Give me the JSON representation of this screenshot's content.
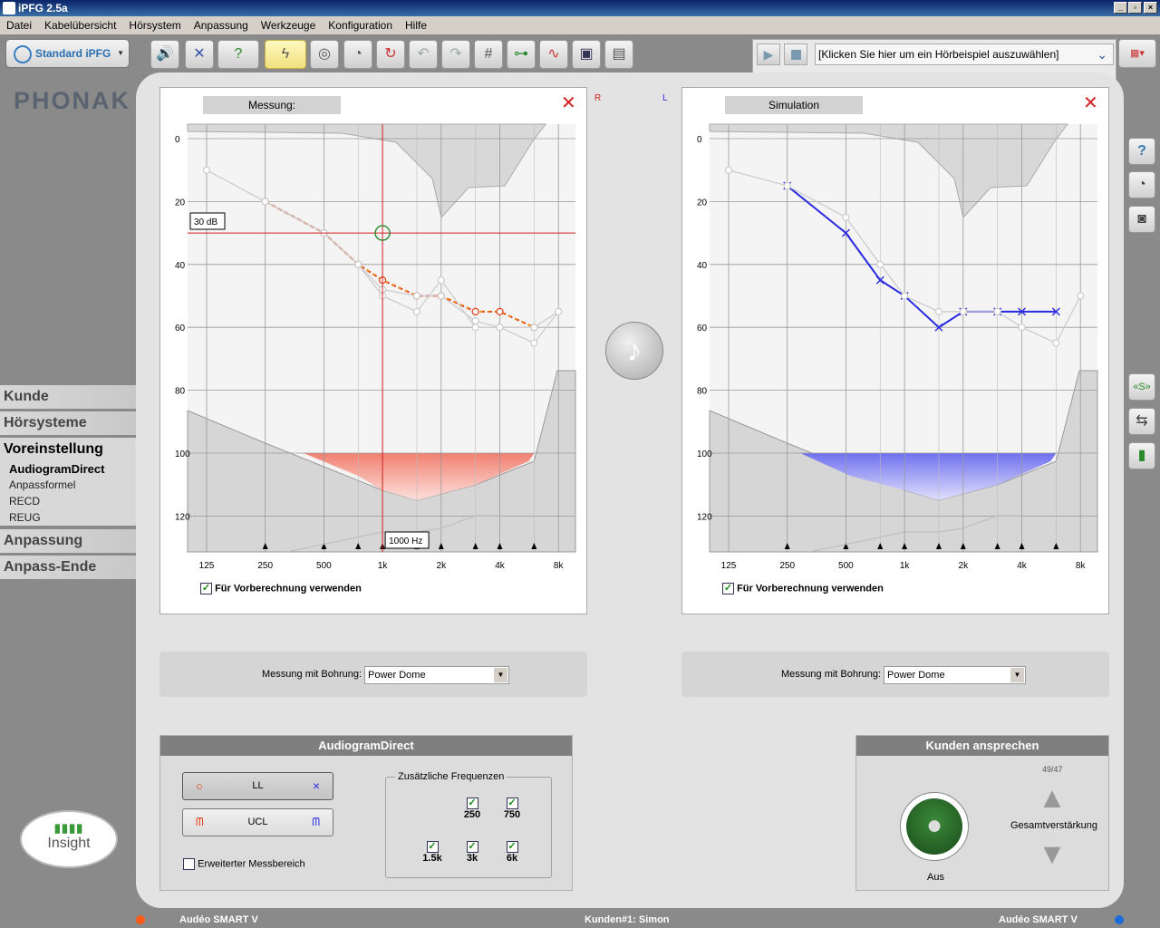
{
  "window": {
    "title": "iPFG 2.5a"
  },
  "menu": [
    "Datei",
    "Kabelübersicht",
    "Hörsystem",
    "Anpassung",
    "Werkzeuge",
    "Konfiguration",
    "Hilfe"
  ],
  "toolbar": {
    "profile_label": "Standard iPFG"
  },
  "sound": {
    "selector_text": "[Klicken Sie hier um ein Hörbeispiel auszuwählen]"
  },
  "brand": {
    "logo": "PHONAK",
    "insight": "Insight"
  },
  "nav": {
    "kunde": "Kunde",
    "horsysteme": "Hörsysteme",
    "voreinstellung": "Voreinstellung",
    "sub": [
      "AudiogramDirect",
      "Anpassformel",
      "RECD",
      "REUG"
    ],
    "anpassung": "Anpassung",
    "anpass_ende": "Anpass-Ende"
  },
  "left_panel": {
    "title": "Messung:",
    "side_label": "R",
    "cursor_db": "30 dB",
    "cursor_freq": "1000 Hz",
    "checkbox": "Für Vorberechnung verwenden"
  },
  "right_panel": {
    "title": "Simulation",
    "side_label": "L",
    "checkbox": "Für Vorberechnung verwenden"
  },
  "bohrung": {
    "label": "Messung mit Bohrung:",
    "value": "Power Dome"
  },
  "audiogram_direct": {
    "title": "AudiogramDirect",
    "ll_label": "LL",
    "ucl_label": "UCL",
    "extended_label": "Erweiterter Messbereich",
    "freq_group": "Zusätzliche Frequenzen",
    "freqs": [
      "250",
      "750",
      "1.5k",
      "3k",
      "6k"
    ]
  },
  "kunden": {
    "title": "Kunden ansprechen",
    "counter": "49/47",
    "gain_label": "Gesamtverstärkung",
    "state": "Aus"
  },
  "status": {
    "left_device": "Audéo SMART V",
    "client": "Kunden#1: Simon",
    "right_device": "Audéo SMART V"
  },
  "colors": {
    "right_ear": "#e23a10",
    "left_ear": "#2a2ae0"
  },
  "chart_data": [
    {
      "type": "line",
      "title": "Messung:",
      "x_ticks": [
        "125",
        "250",
        "500",
        "1k",
        "2k",
        "4k",
        "8k"
      ],
      "y_ticks": [
        0,
        20,
        40,
        60,
        80,
        100,
        120
      ],
      "ylim": [
        0,
        130
      ],
      "y_inverted": true,
      "series": [
        {
          "x": [
            250,
            500,
            750,
            1000,
            1500,
            2000,
            3000,
            4000,
            6000
          ],
          "values": [
            20,
            30,
            40,
            45,
            50,
            50,
            55,
            55,
            60
          ],
          "color": "#e23a10"
        },
        {
          "x": [
            125,
            250,
            500,
            750,
            1000,
            1500,
            2000,
            3000,
            4000,
            6000,
            8000
          ],
          "values": [
            10,
            20,
            30,
            40,
            50,
            55,
            45,
            60,
            60,
            65,
            55
          ],
          "color": "#cccccc"
        },
        {
          "x": [
            250,
            500,
            750,
            1000,
            1500,
            2000,
            3000,
            4000,
            6000,
            8000
          ],
          "values": [
            20,
            30,
            40,
            48,
            50,
            50,
            58,
            60,
            60,
            55
          ],
          "color": "#cccccc"
        }
      ],
      "cursor": {
        "x": 1000,
        "y": 30
      }
    },
    {
      "type": "line",
      "title": "Simulation",
      "x_ticks": [
        "125",
        "250",
        "500",
        "1k",
        "2k",
        "4k",
        "8k"
      ],
      "y_ticks": [
        0,
        20,
        40,
        60,
        80,
        100,
        120
      ],
      "ylim": [
        0,
        130
      ],
      "y_inverted": true,
      "series": [
        {
          "x": [
            250,
            500,
            750,
            1000,
            1500,
            2000,
            3000,
            4000,
            6000
          ],
          "values": [
            15,
            30,
            45,
            50,
            60,
            55,
            55,
            55,
            55
          ],
          "color": "#2a2ae0"
        },
        {
          "x": [
            125,
            250,
            500,
            750,
            1000,
            1500,
            2000,
            3000,
            4000,
            6000,
            8000
          ],
          "values": [
            10,
            15,
            25,
            40,
            50,
            55,
            55,
            55,
            60,
            65,
            50
          ],
          "color": "#cccccc"
        }
      ]
    }
  ]
}
